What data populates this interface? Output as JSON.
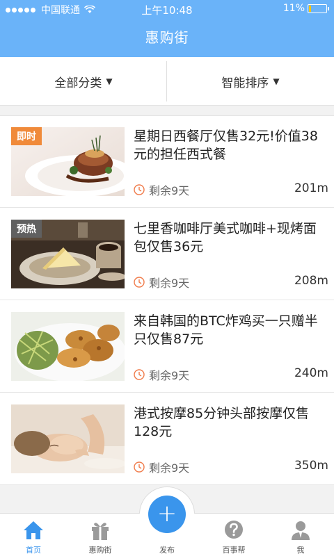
{
  "status_bar": {
    "carrier": "中国联通",
    "time": "上午10:48",
    "battery_percent": "11%",
    "battery_level": 0.11
  },
  "header": {
    "title": "惠购街"
  },
  "filters": [
    {
      "label": "全部分类",
      "icon": "triangle-down-icon"
    },
    {
      "label": "智能排序",
      "icon": "triangle-down-icon"
    }
  ],
  "deals": [
    {
      "tag": "即时",
      "title": "星期日西餐厅仅售32元!价值38元的担任西式餐",
      "remaining": "剩余9天",
      "distance": "201m",
      "image": "steak-dish"
    },
    {
      "tag": "预热",
      "title": "七里香咖啡厅美式咖啡+现烤面包仅售36元",
      "remaining": "剩余9天",
      "distance": "208m",
      "image": "coffee-bread"
    },
    {
      "tag": "",
      "title": "来自韩国的BTC炸鸡买一只赠半只仅售87元",
      "remaining": "剩余9天",
      "distance": "240m",
      "image": "fried-chicken"
    },
    {
      "tag": "",
      "title": "港式按摩85分钟头部按摩仅售128元",
      "remaining": "剩余9天",
      "distance": "350m",
      "image": "head-massage"
    }
  ],
  "tabbar": {
    "tabs": [
      {
        "label": "首页",
        "icon": "home-icon",
        "active": true
      },
      {
        "label": "惠购街",
        "icon": "gift-icon",
        "active": false
      },
      {
        "label": "发布",
        "icon": "plus-icon",
        "active": false
      },
      {
        "label": "百事帮",
        "icon": "question-icon",
        "active": false
      },
      {
        "label": "我",
        "icon": "user-icon",
        "active": false
      }
    ],
    "publish_symbol": "+"
  },
  "colors": {
    "header_bg": "#6ab3f9",
    "accent": "#3a95ec",
    "tag_instant": "#f08a3a",
    "tag_preheat": "#606060",
    "clock": "#f07b4a"
  }
}
